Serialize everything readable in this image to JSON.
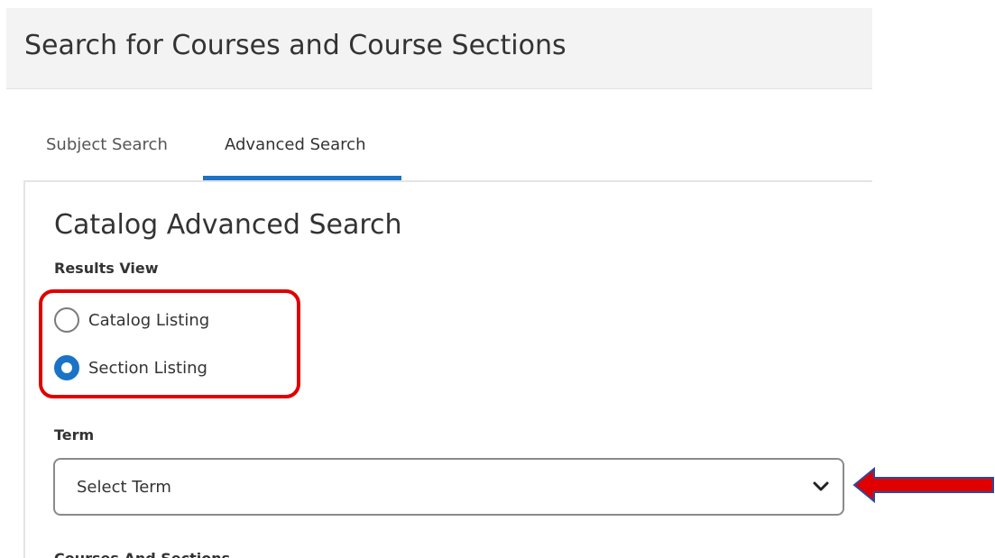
{
  "header": {
    "title": "Search for Courses and Course Sections"
  },
  "tabs": [
    {
      "label": "Subject Search",
      "active": false
    },
    {
      "label": "Advanced Search",
      "active": true
    }
  ],
  "form": {
    "heading": "Catalog Advanced Search",
    "results_view": {
      "label": "Results View",
      "options": [
        {
          "label": "Catalog Listing",
          "selected": false
        },
        {
          "label": "Section Listing",
          "selected": true
        }
      ]
    },
    "term": {
      "label": "Term",
      "selected_value": "Select Term"
    },
    "courses_and_sections": {
      "label": "Courses And Sections"
    }
  },
  "icons": {
    "select_chevron": "chevron-down-icon",
    "annotation_arrow": "arrow-left-icon"
  },
  "colors": {
    "accent": "#1a73c7",
    "annotation": "#e00000",
    "header_bg": "#f3f3f3",
    "text": "#333333"
  }
}
